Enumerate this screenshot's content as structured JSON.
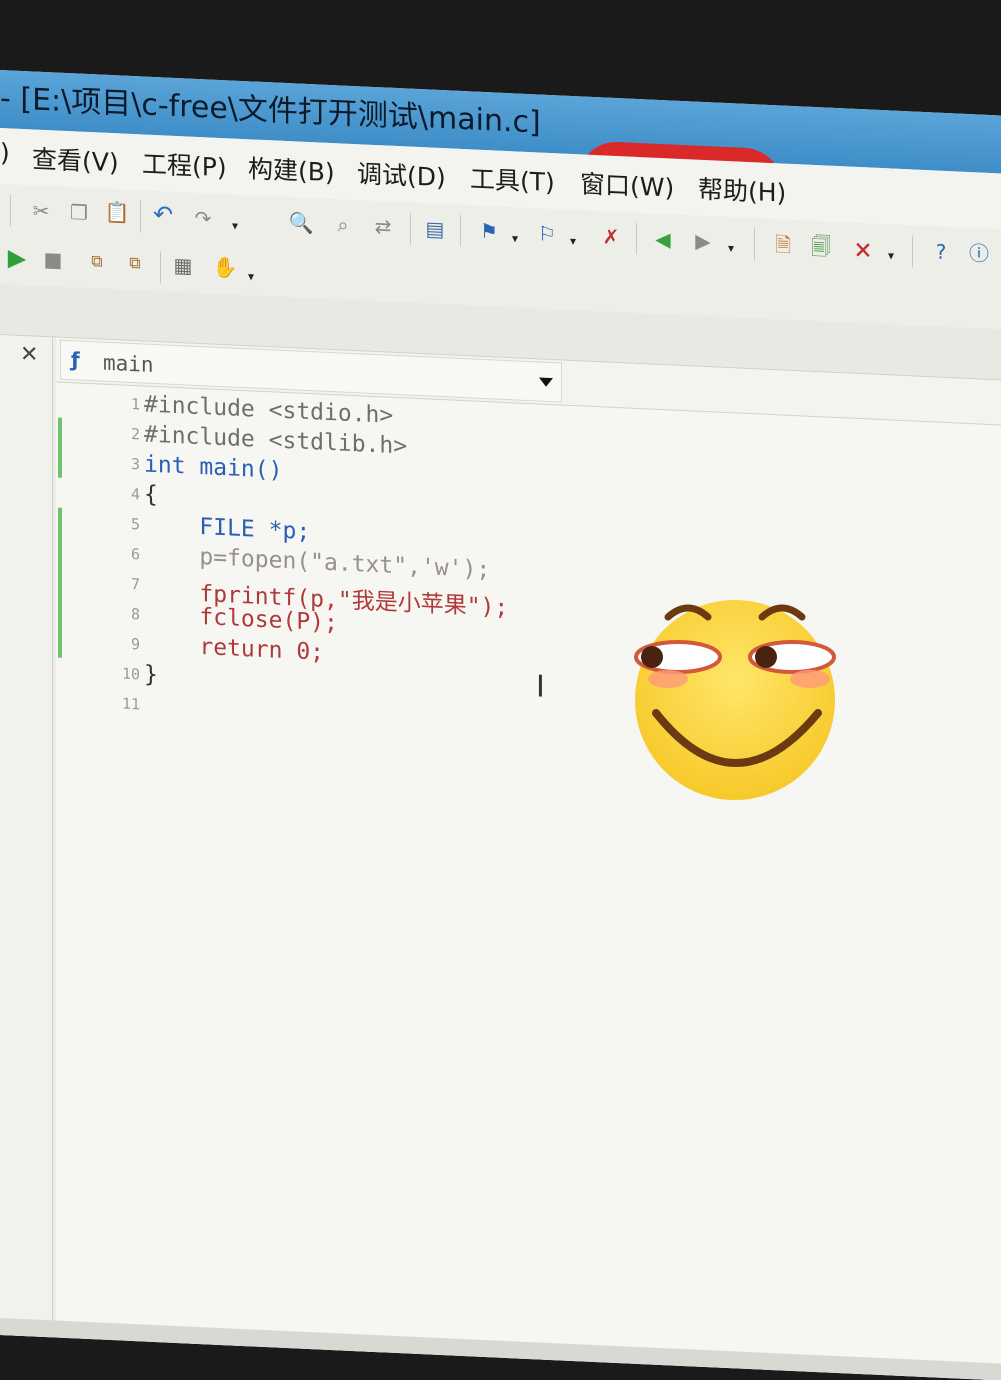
{
  "window": {
    "title": "- [E:\\项目\\c-free\\文件打开测试\\main.c]"
  },
  "menubar": {
    "items": [
      ")",
      "查看(V)",
      "工程(P)",
      "构建(B)",
      "调试(D)",
      "工具(T)",
      "窗口(W)",
      "帮助(H)"
    ]
  },
  "toolbar": {
    "row1_icons": [
      "cut-icon",
      "copy-icon",
      "paste-icon",
      "undo-icon",
      "redo-icon",
      "find-icon",
      "find-next-icon",
      "replace-icon",
      "goto-icon",
      "bookmark-icon",
      "bookmark-next-icon",
      "bookmark-clear-icon",
      "back-icon",
      "forward-icon",
      "new-file-icon",
      "save-icon",
      "close-file-icon",
      "help-icon",
      "info-icon"
    ],
    "row2_icons": [
      "run-icon",
      "stop-icon",
      "compile-icon",
      "build-icon",
      "rebuild-icon",
      "hand-icon"
    ]
  },
  "panel": {
    "close_label": "✕"
  },
  "editor": {
    "function_selector": "main",
    "lines": [
      {
        "no": "1",
        "code": "#include <stdio.h>"
      },
      {
        "no": "2",
        "code": "#include <stdlib.h>"
      },
      {
        "no": "3",
        "code": "int main()"
      },
      {
        "no": "4",
        "code": "{"
      },
      {
        "no": "5",
        "code": "    FILE *p;"
      },
      {
        "no": "6",
        "code": "    p=fopen(\"a.txt\",'w');"
      },
      {
        "no": "7",
        "code": "    fprintf(p,\"我是小苹果\");"
      },
      {
        "no": "8",
        "code": "    fclose(P);"
      },
      {
        "no": "9",
        "code": "    return 0;"
      },
      {
        "no": "10",
        "code": "}"
      },
      {
        "no": "11",
        "code": ""
      }
    ]
  },
  "overlay": {
    "emoji": "smirking-face-emoji"
  },
  "colors": {
    "keyword": "#2a5fb5",
    "function": "#b03a3a",
    "string": "#9a8f8f",
    "include": "#1e8c8c",
    "titlebar": "#4a98d0"
  }
}
